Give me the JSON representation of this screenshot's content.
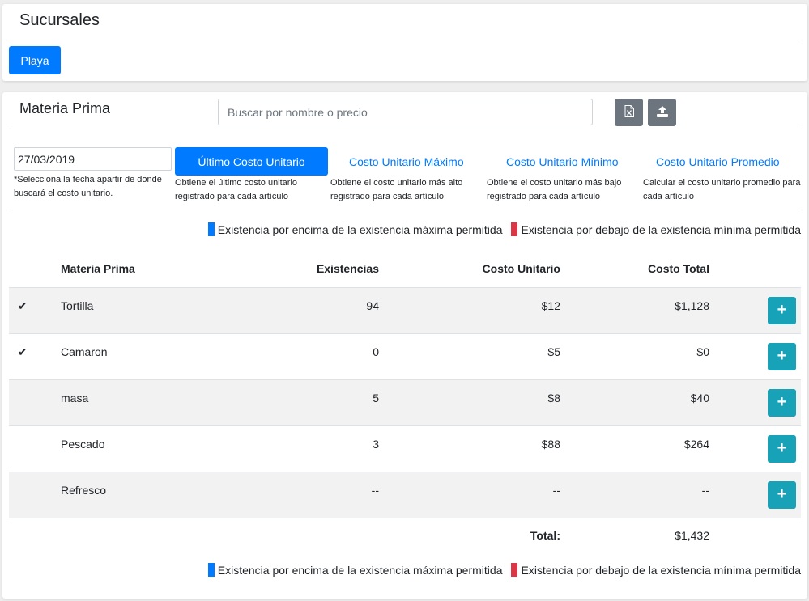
{
  "sucursales": {
    "title": "Sucursales",
    "branch_button": "Playa"
  },
  "materia_prima": {
    "title": "Materia Prima",
    "search_placeholder": "Buscar por nombre o precio",
    "excel_icon": "excel-file-icon",
    "upload_icon": "upload-icon",
    "date_value": "27/03/2019",
    "date_help": "*Selecciona la fecha apartir de donde buscará el costo unitario.",
    "options": [
      {
        "label": "Último Costo Unitario",
        "desc": "Obtiene el último costo unitario registrado para cada artículo",
        "active": true
      },
      {
        "label": "Costo Unitario Máximo",
        "desc": "Obtiene el costo unitario más alto registrado para cada artículo",
        "active": false
      },
      {
        "label": "Costo Unitario Mínimo",
        "desc": "Obtiene el costo unitario más bajo registrado para cada artículo",
        "active": false
      },
      {
        "label": "Costo Unitario Promedio",
        "desc": "Calcular el costo unitario promedio para cada artículo",
        "active": false
      }
    ],
    "legend": {
      "above_max": "Existencia por encima de la existencia máxima permitida",
      "below_min": "Existencia por debajo de la existencia mínima permitida",
      "above_color": "#007bff",
      "below_color": "#dc3545"
    },
    "table": {
      "headers": [
        "",
        "Materia Prima",
        "Existencias",
        "Costo Unitario",
        "Costo Total",
        ""
      ],
      "rows": [
        {
          "checked": "✔",
          "name": "Tortilla",
          "existencias": "94",
          "costo_unitario": "$12",
          "costo_total": "$1,128"
        },
        {
          "checked": "✔",
          "name": "Camaron",
          "existencias": "0",
          "costo_unitario": "$5",
          "costo_total": "$0"
        },
        {
          "checked": "",
          "name": "masa",
          "existencias": "5",
          "costo_unitario": "$8",
          "costo_total": "$40"
        },
        {
          "checked": "",
          "name": "Pescado",
          "existencias": "3",
          "costo_unitario": "$88",
          "costo_total": "$264"
        },
        {
          "checked": "",
          "name": "Refresco",
          "existencias": "--",
          "costo_unitario": "--",
          "costo_total": "--"
        }
      ],
      "add_label": "+",
      "total_label": "Total:",
      "total_value": "$1,432"
    }
  }
}
